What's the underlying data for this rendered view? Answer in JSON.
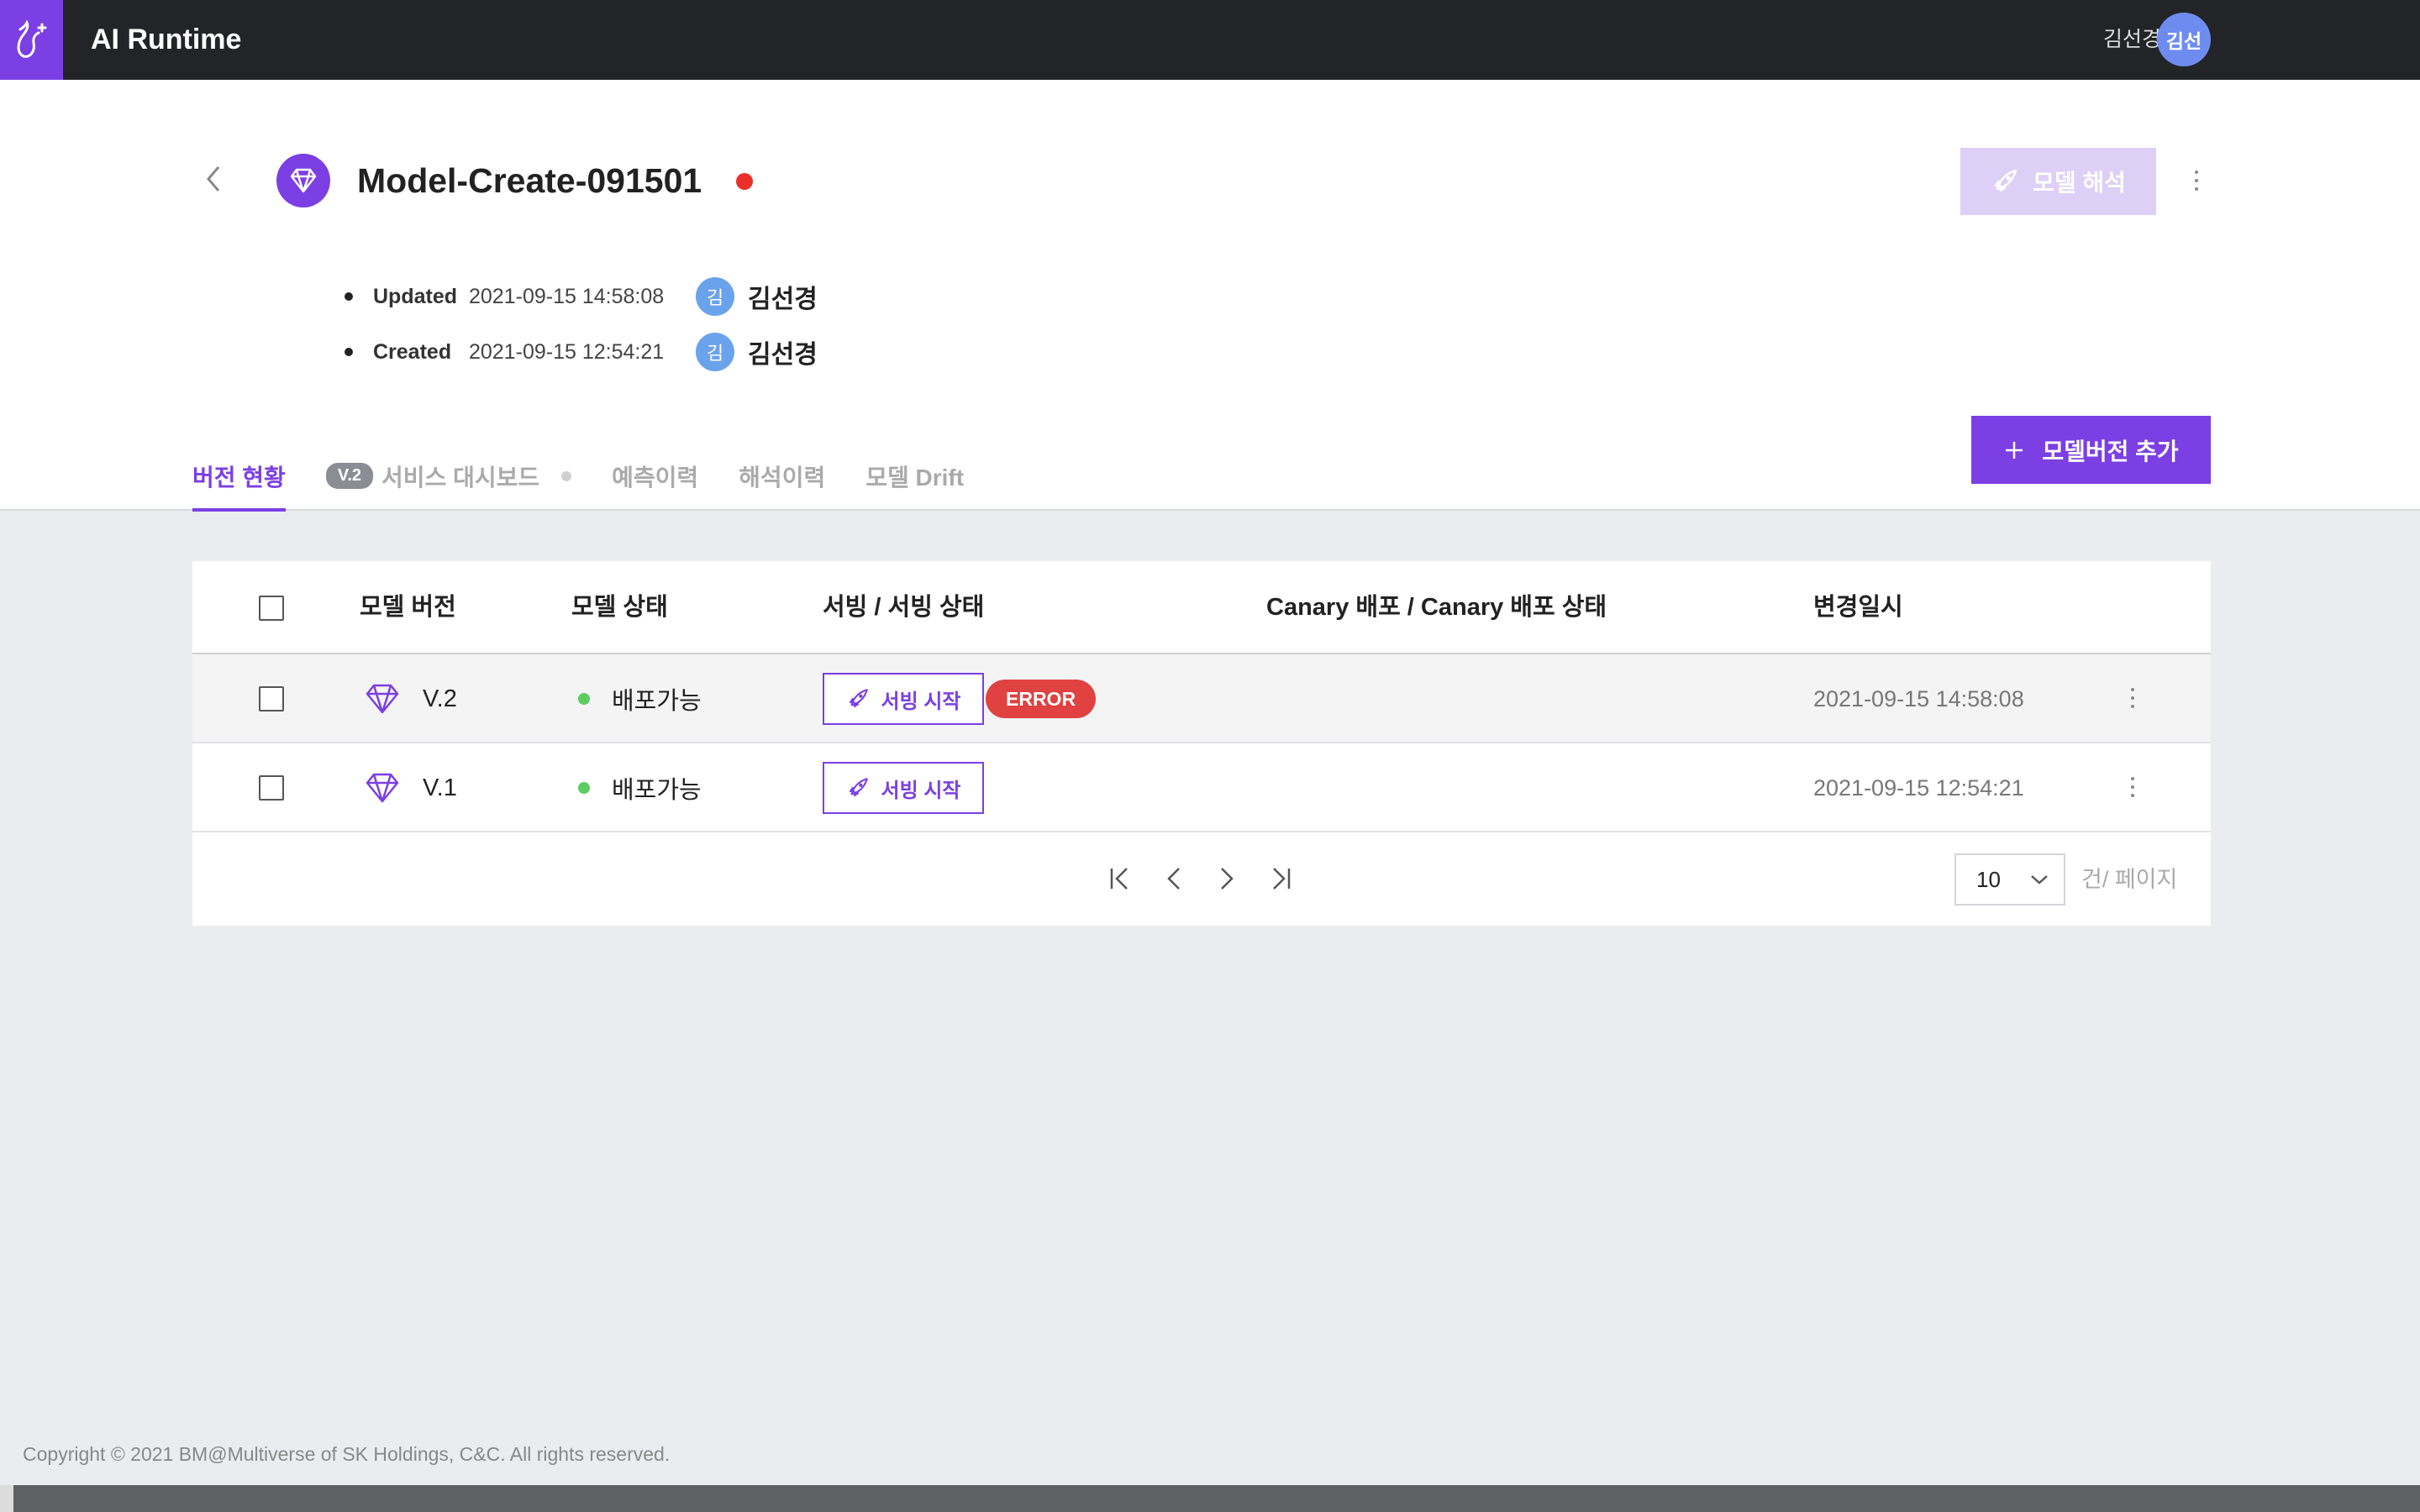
{
  "app": {
    "title": "AI Runtime"
  },
  "user": {
    "name": "김선경",
    "avatar": "김선"
  },
  "model": {
    "name": "Model-Create-091501",
    "status_color": "#e8312a",
    "updated_label": "Updated",
    "updated_at": "2021-09-15 14:58:08",
    "updated_by_avatar": "김",
    "updated_by": "김선경",
    "created_label": "Created",
    "created_at": "2021-09-15 12:54:21",
    "created_by_avatar": "김",
    "created_by": "김선경"
  },
  "actions": {
    "interpret_label": "모델 해석",
    "add_version_label": "모델버전 추가"
  },
  "tabs": [
    {
      "label": "버전 현황",
      "active": true
    },
    {
      "badge": "V.2",
      "label": "서비스 대시보드"
    },
    {
      "label": "예측이력"
    },
    {
      "label": "해석이력"
    },
    {
      "label": "모델 Drift"
    }
  ],
  "table": {
    "columns": [
      "모델 버전",
      "모델 상태",
      "서빙 / 서빙 상태",
      "Canary 배포 / Canary 배포 상태",
      "변경일시"
    ],
    "rows": [
      {
        "version": "V.2",
        "state": "배포가능",
        "serve_label": "서빙 시작",
        "serve_status": "ERROR",
        "canary": "",
        "updated": "2021-09-15 14:58:08"
      },
      {
        "version": "V.1",
        "state": "배포가능",
        "serve_label": "서빙 시작",
        "serve_status": "",
        "canary": "",
        "updated": "2021-09-15 12:54:21"
      }
    ]
  },
  "pagination": {
    "page_size": "10",
    "unit_label": "건/ 페이지"
  },
  "footer": {
    "copyright": "Copyright © 2021 BM@Multiverse of SK Holdings, C&C. All rights reserved."
  },
  "colors": {
    "accent": "#7b3fe4",
    "error": "#e04141",
    "ok": "#5ccd60",
    "topbar": "#232427"
  }
}
